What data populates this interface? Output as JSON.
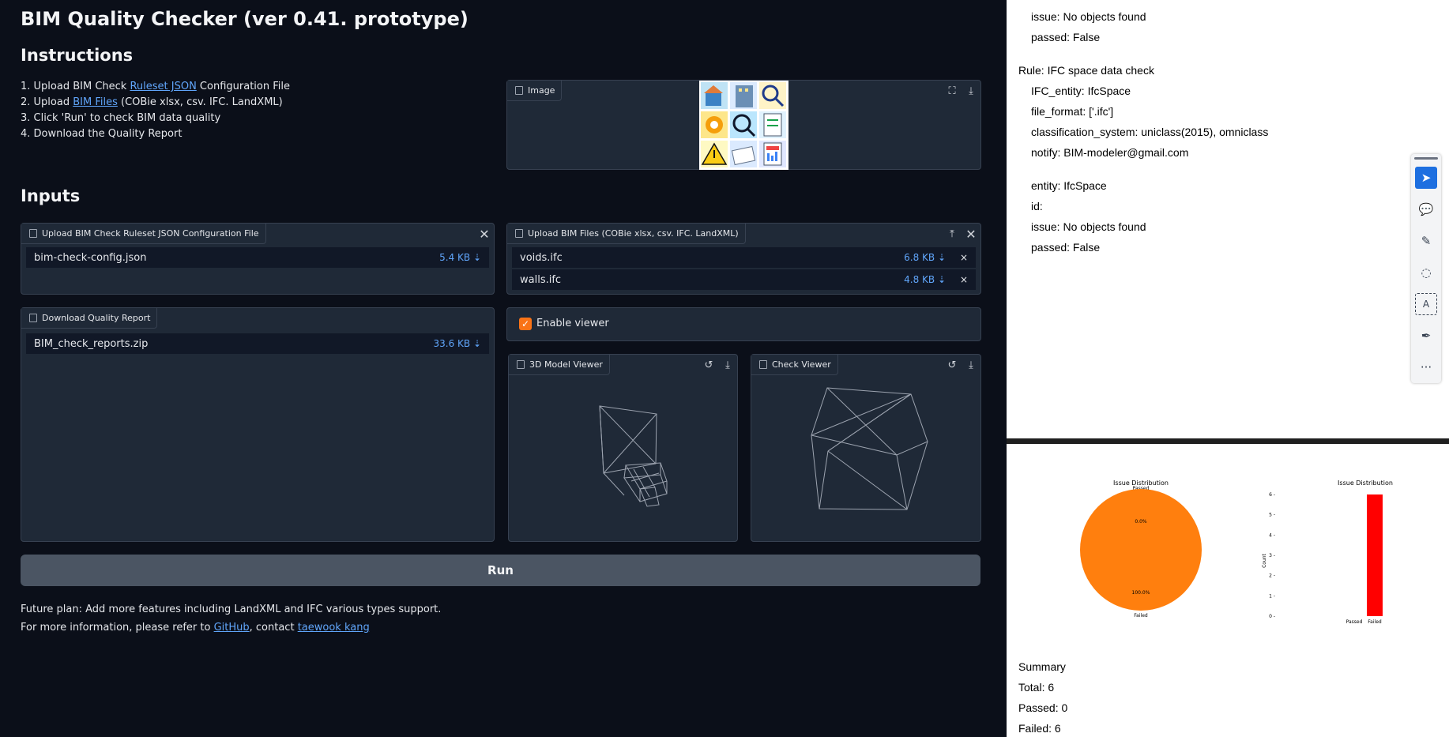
{
  "app": {
    "title": "BIM Quality Checker (ver 0.41. prototype)",
    "instructions_heading": "Instructions",
    "instructions": {
      "step1_prefix": "1. Upload BIM Check ",
      "step1_link": "Ruleset JSON",
      "step1_suffix": " Configuration File",
      "step2_prefix": "2. Upload ",
      "step2_link": "BIM Files",
      "step2_suffix": " (COBie xlsx, csv. IFC. LandXML)",
      "step3": "3. Click 'Run' to check BIM data quality",
      "step4": "4. Download the Quality Report"
    },
    "image_label": "Image",
    "inputs_heading": "Inputs",
    "ruleset_upload": {
      "label": "Upload BIM Check Ruleset JSON Configuration File",
      "files": [
        {
          "name": "bim-check-config.json",
          "size": "5.4 KB"
        }
      ]
    },
    "bim_upload": {
      "label": "Upload BIM Files (COBie xlsx, csv. IFC. LandXML)",
      "files": [
        {
          "name": "voids.ifc",
          "size": "6.8 KB"
        },
        {
          "name": "walls.ifc",
          "size": "4.8 KB"
        }
      ]
    },
    "report": {
      "label": "Download Quality Report",
      "files": [
        {
          "name": "BIM_check_reports.zip",
          "size": "33.6 KB"
        }
      ]
    },
    "enable_viewer": {
      "label": "Enable viewer",
      "checked": true
    },
    "model_viewer_label": "3D Model Viewer",
    "check_viewer_label": "Check Viewer",
    "run_label": "Run",
    "footer": {
      "line1": "Future plan: Add more features including LandXML and IFC various types support.",
      "line2_prefix": "For more information, please refer to ",
      "github": "GitHub",
      "line2_mid": ", contact ",
      "contact": "taewook kang"
    }
  },
  "report_panel": {
    "lines": [
      "issue: No objects found",
      "passed: False",
      "Rule: IFC space data check",
      "IFC_entity: IfcSpace",
      "file_format: ['.ifc']",
      "classification_system: uniclass(2015), omniclass",
      "notify: BIM-modeler@gmail.com",
      "entity: IfcSpace",
      "id:",
      "issue: No objects found",
      "passed: False"
    ],
    "summary": {
      "heading": "Summary",
      "total": "Total: 6",
      "passed": "Passed: 0",
      "failed": "Failed: 6"
    }
  },
  "chart_data": [
    {
      "type": "pie",
      "title": "Issue Distribution",
      "categories": [
        "Passed",
        "Failed"
      ],
      "values": [
        0,
        6
      ],
      "labels": [
        "0.0%",
        "100.0%"
      ],
      "colors": [
        "#1f77b4",
        "#ff7f0e"
      ]
    },
    {
      "type": "bar",
      "title": "Issue Distribution",
      "categories": [
        "Passed",
        "Failed"
      ],
      "values": [
        0,
        6
      ],
      "ylabel": "Count",
      "ylim": [
        0,
        6
      ],
      "yticks": [
        "0",
        "1",
        "2",
        "3",
        "4",
        "5",
        "6"
      ],
      "colors": [
        "#008000",
        "#ff0000"
      ]
    }
  ],
  "toolbar": {
    "icons": [
      "cursor-icon",
      "comment-icon",
      "pen-icon",
      "lasso-icon",
      "text-box-icon",
      "highlighter-icon",
      "more-icon"
    ],
    "more_label": "···"
  },
  "colors": {
    "accent": "#f97316",
    "link": "#60a5fa",
    "background": "#0b0f19"
  }
}
